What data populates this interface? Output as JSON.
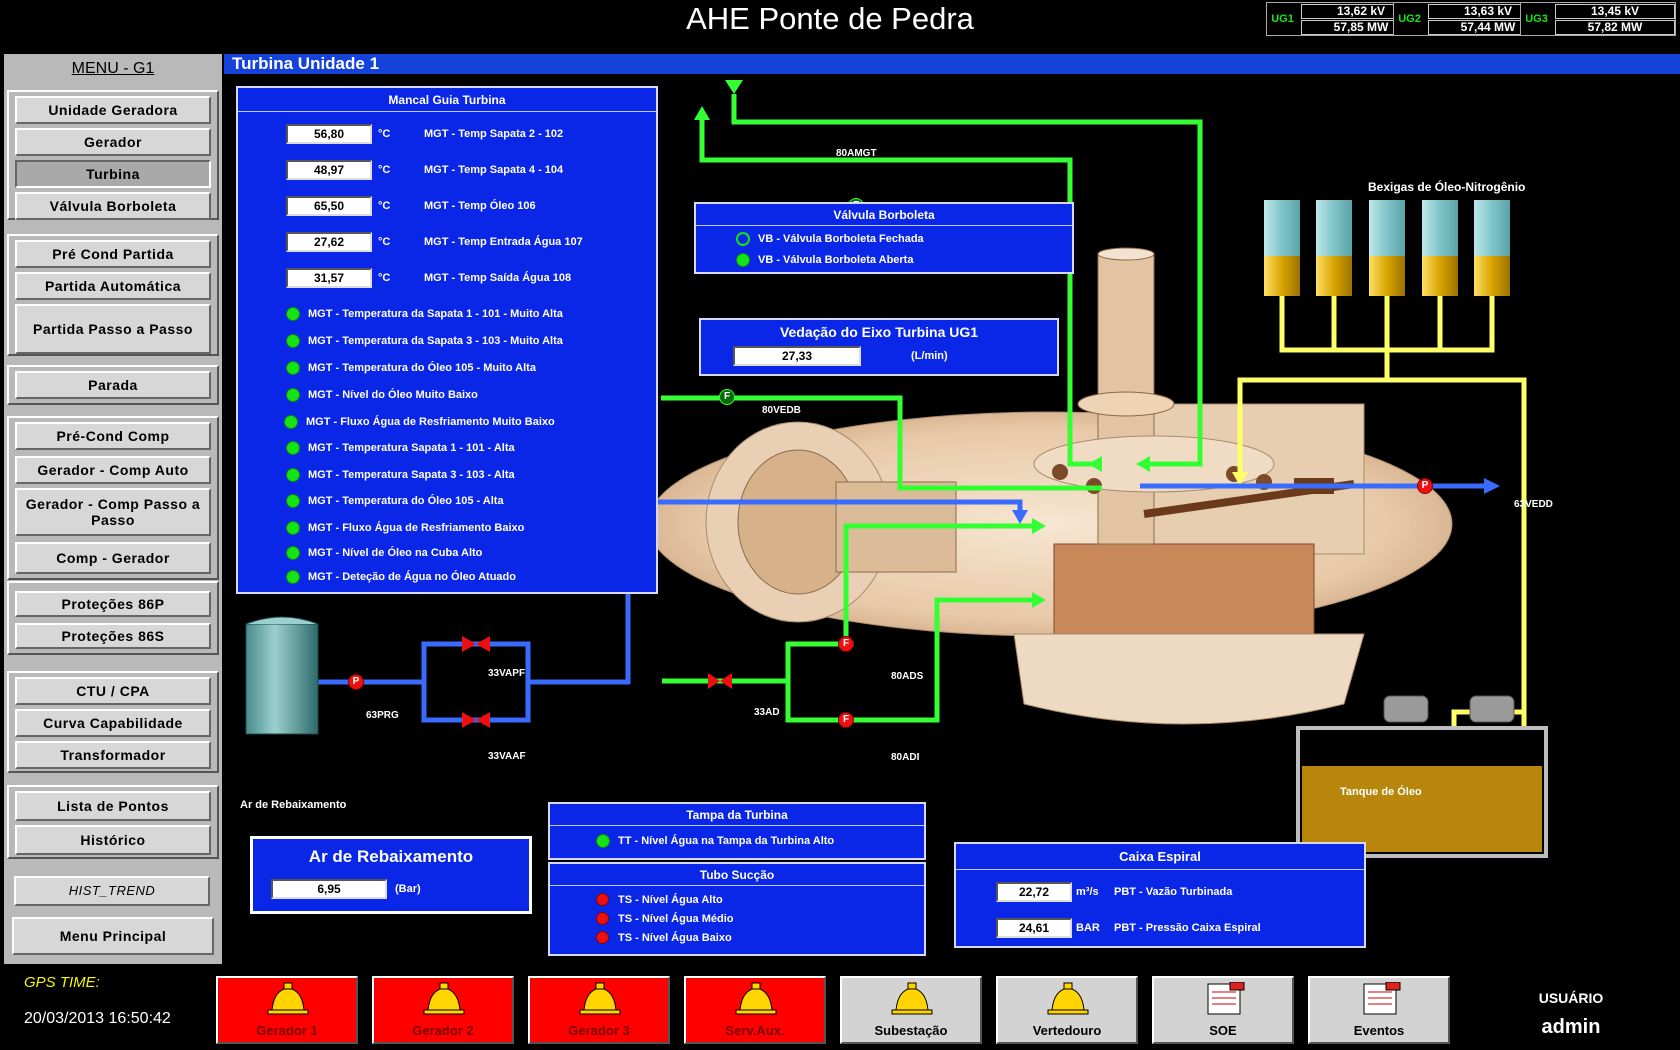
{
  "title": "AHE Ponte de Pedra",
  "units": [
    {
      "name": "UG1",
      "voltage": "13,62  kV",
      "power": "57,85  MW"
    },
    {
      "name": "UG2",
      "voltage": "13,63  kV",
      "power": "57,44  MW"
    },
    {
      "name": "UG3",
      "voltage": "13,45  kV",
      "power": "57,82  MW"
    }
  ],
  "menu": {
    "title": "MENU - G1",
    "items": [
      "Unidade Geradora",
      "Gerador",
      "Turbina",
      "Válvula Borboleta",
      "Pré Cond Partida",
      "Partida Automática",
      "Partida Passo a Passo",
      "Parada",
      "Pré-Cond Comp",
      "Gerador - Comp Auto",
      "Gerador - Comp Passo a Passo",
      "Comp - Gerador",
      "Proteções 86P",
      "Proteções 86S",
      "CTU / CPA",
      "Curva Capabilidade",
      "Transformador",
      "Lista de Pontos",
      "Histórico",
      "HIST_TREND",
      "Menu Principal"
    ],
    "active": "Turbina"
  },
  "page_title": "Turbina Unidade 1",
  "mancal": {
    "title": "Mancal Guia Turbina",
    "unit": "°C",
    "readings": [
      {
        "value": "56,80",
        "label": "MGT - Temp Sapata 2 - 102"
      },
      {
        "value": "48,97",
        "label": "MGT - Temp Sapata 4 - 104"
      },
      {
        "value": "65,50",
        "label": "MGT - Temp Óleo 106"
      },
      {
        "value": "27,62",
        "label": "MGT - Temp Entrada Água 107"
      },
      {
        "value": "31,57",
        "label": "MGT - Temp Saída Água 108"
      }
    ],
    "alarms": [
      "MGT - Temperatura da Sapata 1 - 101 - Muito Alta",
      "MGT - Temperatura da Sapata 3 - 103 -  Muito Alta",
      "MGT - Temperatura do Óleo 105 - Muito Alta",
      "MGT - Nível do Óleo Muito Baixo",
      "MGT - Fluxo Água de Resfriamento Muito Baixo",
      "MGT - Temperatura Sapata 1 - 101 - Alta",
      "MGT - Temperatura Sapata 3 - 103 - Alta",
      "MGT - Temperatura do Óleo 105 - Alta",
      "MGT - Fluxo Água de Resfriamento Baixo",
      "MGT - Nível de Óleo na Cuba Alto",
      "MGT - Deteção de Água no Óleo Atuado"
    ]
  },
  "valvula": {
    "title": "Válvula Borboleta",
    "items": [
      "VB - Válvula Borboleta Fechada",
      "VB - Válvula Borboleta Aberta"
    ]
  },
  "vedacao": {
    "title": "Vedação do Eixo Turbina UG1",
    "value": "27,33",
    "unit": "(L/min)"
  },
  "ar": {
    "title": "Ar de Rebaixamento",
    "value": "6,95",
    "unit": "(Bar)",
    "tank_label": "Ar de Rebaixamento"
  },
  "tampa": {
    "title": "Tampa da Turbina",
    "item": "TT - Nível Água na Tampa da Turbina Alto"
  },
  "tubo": {
    "title": "Tubo Sucção",
    "items": [
      "TS - Nível Água Alto",
      "TS - Nível Água Médio",
      "TS - Nível Água  Baixo"
    ]
  },
  "caixa": {
    "title": "Caixa Espiral",
    "rows": [
      {
        "value": "22,72",
        "unit": "m³/s",
        "label": "PBT - Vazão Turbinada"
      },
      {
        "value": "24,61",
        "unit": "BAR",
        "label": "PBT - Pressão Caixa Espiral"
      }
    ]
  },
  "diagram": {
    "tags": [
      "80AMGT",
      "80VEDB",
      "63VEDD",
      "63PRG",
      "33VAPF",
      "33VAAF",
      "33AD",
      "80ADS",
      "80ADI"
    ],
    "bexigas": "Bexigas de Óleo-Nitrogênio",
    "tanque": "Tanque de Óleo",
    "sensor_letters": {
      "flow": "F",
      "pressure": "P"
    }
  },
  "bottom": {
    "gps_label": "GPS TIME:",
    "gps_time": "20/03/2013 16:50:42",
    "alarms": [
      {
        "label": "Gerador 1",
        "state": "red"
      },
      {
        "label": "Gerador 2",
        "state": "red"
      },
      {
        "label": "Gerador 3",
        "state": "red"
      },
      {
        "label": "Serv.Aux.",
        "state": "red"
      },
      {
        "label": "Subestação",
        "state": "gray"
      },
      {
        "label": "Vertedouro",
        "state": "gray"
      },
      {
        "label": "SOE",
        "state": "gray"
      },
      {
        "label": "Eventos",
        "state": "gray"
      }
    ],
    "user_label": "USUÁRIO",
    "user": "admin"
  },
  "colors": {
    "panel": "#0a26e6",
    "header": "#1542d8",
    "pipe_green": "#33ff33",
    "pipe_blue": "#0050ff",
    "pipe_yellow": "#ffff66",
    "alarm_red": "#ff0000"
  }
}
